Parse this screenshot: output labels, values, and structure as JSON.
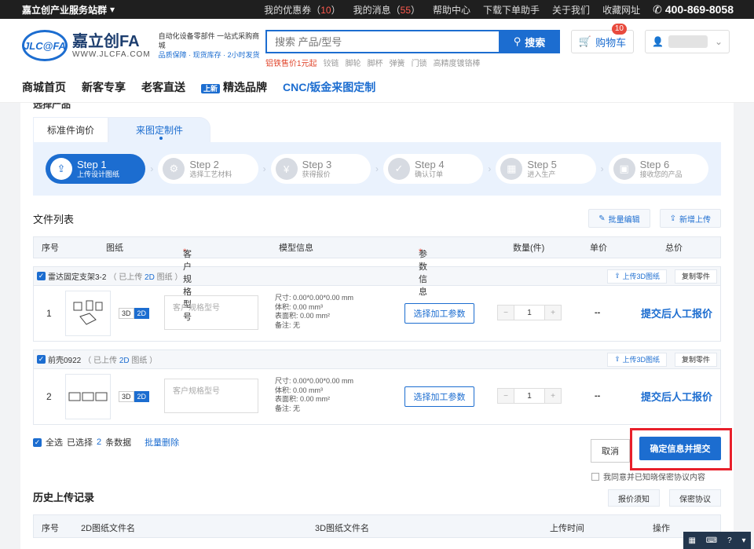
{
  "topbar": {
    "brand": "嘉立创产业服务站群",
    "coupon_label": "我的优惠券（",
    "coupon_count": "10",
    "coupon_close": "）",
    "msg_label": "我的消息（",
    "msg_count": "55",
    "msg_close": "）",
    "help": "帮助中心",
    "download": "下载下单助手",
    "about": "关于我们",
    "favorite": "收藏网址",
    "hotline": "400-869-8058"
  },
  "header": {
    "logo_mark": "JLC@FA",
    "logo_name": "嘉立创FA",
    "logo_url": "WWW.JLCFA.COM",
    "slogan_1": "自动化设备零部件 一站式采购商城",
    "slogan_2": "品质保障 · 现货库存 · 2小时发货",
    "search_placeholder": "搜索 产品/型号",
    "search_button": "搜索",
    "hotwords": [
      "铝铁售价1元起",
      "铰链",
      "脚轮",
      "脚杯",
      "弹簧",
      "门锁",
      "高精度镀铬棒"
    ],
    "cart_label": "购物车",
    "cart_count": "10"
  },
  "nav": {
    "items": [
      "商城首页",
      "新客专享",
      "老客直送"
    ],
    "tag": "上新",
    "brand_item": "精选品牌",
    "cnc_item": "CNC/钣金来图定制"
  },
  "main": {
    "clipped_title": "选择产品",
    "tabs": [
      "标准件询价",
      "来图定制件"
    ],
    "steps": [
      {
        "title": "Step 1",
        "desc": "上传设计图纸"
      },
      {
        "title": "Step 2",
        "desc": "选择工艺材料"
      },
      {
        "title": "Step 3",
        "desc": "获得报价"
      },
      {
        "title": "Step 4",
        "desc": "确认订单"
      },
      {
        "title": "Step 5",
        "desc": "进入生产"
      },
      {
        "title": "Step 6",
        "desc": "接收您的产品"
      }
    ],
    "file_list_title": "文件列表",
    "batch_edit": "批量编辑",
    "add_upload": "新增上传",
    "columns": {
      "index": "序号",
      "drawing": "图纸",
      "spec": "客户规格型号",
      "model": "模型信息",
      "params": "参数信息",
      "qty": "数量(件)",
      "unit": "单价",
      "total": "总价"
    },
    "files": [
      {
        "name": "雷达固定支架3-2",
        "status_pre": "（ 已上传 ",
        "status_type": "2D",
        "status_post": " 图纸 ）",
        "index": "1",
        "dim_3d": "3D",
        "dim_2d": "2D",
        "spec_placeholder": "客户规格型号",
        "size": "尺寸: 0.00*0.00*0.00 mm",
        "volume": "体积: 0.00 mm³",
        "area": "表面积: 0.00 mm²",
        "remark": "备注: 无",
        "param_button": "选择加工参数",
        "qty_minus": "−",
        "qty": "1",
        "qty_plus": "+",
        "unit_price": "--",
        "total_price": "提交后人工报价",
        "upload_3d": "上传3D图纸",
        "copy": "复制零件"
      },
      {
        "name": "前壳0922",
        "status_pre": "（ 已上传 ",
        "status_type": "2D",
        "status_post": " 图纸 ）",
        "index": "2",
        "dim_3d": "3D",
        "dim_2d": "2D",
        "spec_placeholder": "客户规格型号",
        "size": "尺寸: 0.00*0.00*0.00 mm",
        "volume": "体积: 0.00 mm³",
        "area": "表面积: 0.00 mm²",
        "remark": "备注: 无",
        "param_button": "选择加工参数",
        "qty_minus": "−",
        "qty": "1",
        "qty_plus": "+",
        "unit_price": "--",
        "total_price": "提交后人工报价",
        "upload_3d": "上传3D图纸",
        "copy": "复制零件"
      }
    ],
    "select_all": "全选",
    "selected_pre": "已选择",
    "selected_count": "2",
    "selected_post": "条数据",
    "batch_delete": "批量删除",
    "cancel": "取消",
    "confirm": "确定信息并提交",
    "agree": "我同意并已知晓保密协议内容",
    "history_title": "历史上传记录",
    "quote_notice": "报价须知",
    "privacy": "保密协议",
    "history_columns": {
      "index": "序号",
      "file2d": "2D图纸文件名",
      "file3d": "3D图纸文件名",
      "time": "上传时间",
      "op": "操作"
    }
  },
  "colors": {
    "accent": "#1c6dd0",
    "highlight": "#e8202b"
  }
}
